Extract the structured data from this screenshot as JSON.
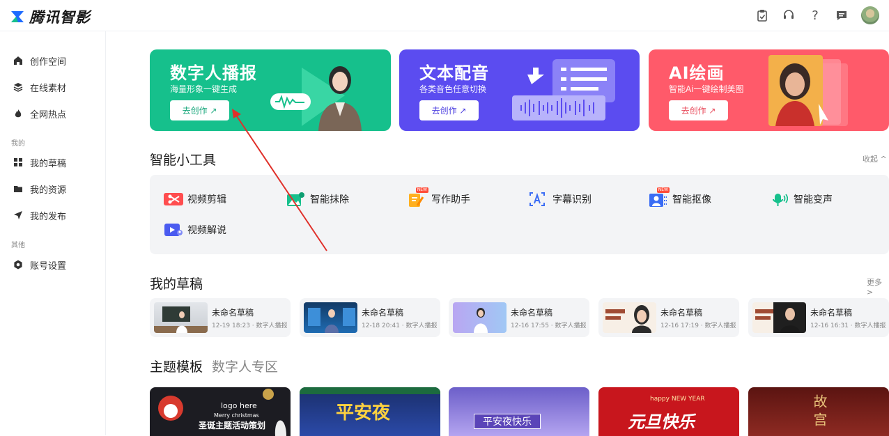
{
  "app": {
    "title": "腾讯智影"
  },
  "header": {
    "icons": [
      "clipboard-icon",
      "headset-icon",
      "help-icon",
      "message-icon",
      "user-avatar"
    ],
    "help_glyph": "?"
  },
  "sidebar": {
    "items": [
      {
        "label": "创作空间",
        "icon": "home-icon"
      },
      {
        "label": "在线素材",
        "icon": "layers-icon"
      },
      {
        "label": "全网热点",
        "icon": "fire-icon"
      }
    ],
    "group_mine": "我的",
    "mine_items": [
      {
        "label": "我的草稿",
        "icon": "grid-icon"
      },
      {
        "label": "我的资源",
        "icon": "folder-icon"
      },
      {
        "label": "我的发布",
        "icon": "send-icon"
      }
    ],
    "group_other": "其他",
    "other_items": [
      {
        "label": "账号设置",
        "icon": "settings-icon"
      }
    ]
  },
  "banners": [
    {
      "title": "数字人播报",
      "subtitle": "海量形象一键生成",
      "button": "去创作 ↗",
      "color": "#16c08c"
    },
    {
      "title": "文本配音",
      "subtitle": "各类音色任意切换",
      "button": "去创作 ↗",
      "color": "#5b4cf0"
    },
    {
      "title": "AI绘画",
      "subtitle": "智能Ai一键绘制美图",
      "button": "去创作 ↗",
      "color": "#ff5a6a"
    }
  ],
  "tools": {
    "title": "智能小工具",
    "collapse": "收起 ^",
    "items": [
      {
        "label": "视频剪辑",
        "icon": "video-edit-icon"
      },
      {
        "label": "智能抹除",
        "icon": "erase-icon"
      },
      {
        "label": "写作助手",
        "icon": "writing-icon",
        "badge": "NEW"
      },
      {
        "label": "字幕识别",
        "icon": "subtitle-icon"
      },
      {
        "label": "智能抠像",
        "icon": "matting-icon",
        "badge": "NEW"
      },
      {
        "label": "智能变声",
        "icon": "voice-change-icon"
      },
      {
        "label": "视频解说",
        "icon": "video-narration-icon"
      }
    ]
  },
  "drafts": {
    "title": "我的草稿",
    "more": "更多 >",
    "items": [
      {
        "name": "未命名草稿",
        "meta": "12-19 18:23 · 数字人播报"
      },
      {
        "name": "未命名草稿",
        "meta": "12-18 20:41 · 数字人播报"
      },
      {
        "name": "未命名草稿",
        "meta": "12-16 17:55 · 数字人播报"
      },
      {
        "name": "未命名草稿",
        "meta": "12-16 17:19 · 数字人播报"
      },
      {
        "name": "未命名草稿",
        "meta": "12-16 16:31 · 数字人播报"
      }
    ]
  },
  "templates": {
    "title": "主题模板",
    "tab2": "数字人专区",
    "items": [
      {
        "text": "圣诞主题活动策划",
        "logo": "logo here",
        "sub": "Merry christmas"
      },
      {
        "text": "平安夜"
      },
      {
        "text": "平安夜快乐"
      },
      {
        "text": "元旦快乐",
        "sub": "happy NEW YEAR"
      },
      {
        "text": "故宫"
      }
    ]
  }
}
